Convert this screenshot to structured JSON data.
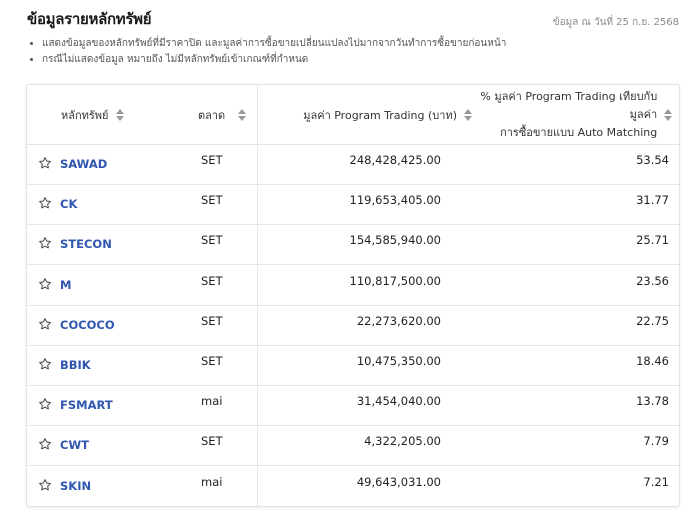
{
  "header": {
    "title": "ข้อมูลรายหลักทรัพย์",
    "as_of": "ข้อมูล ณ วันที่ 25 ก.ย. 2568"
  },
  "notes": [
    "แสดงข้อมูลของหลักทรัพย์ที่มีราคาปิด และมูลค่าการซื้อขายเปลี่ยนแปลงไปมากจากวันทำการซื้อขายก่อนหน้า",
    "กรณีไม่แสดงข้อมูล หมายถึง ไม่มีหลักทรัพย์เข้าเกณฑ์ที่กำหนด"
  ],
  "table": {
    "columns": {
      "symbol": "หลักทรัพย์",
      "market": "ตลาด",
      "value": "มูลค่า Program Trading (บาท)",
      "pct_line1": "% มูลค่า Program Trading เทียบกับมูลค่า",
      "pct_line2": "การซื้อขายแบบ Auto Matching"
    },
    "rows": [
      {
        "symbol": "SAWAD",
        "market": "SET",
        "value": "248,428,425.00",
        "pct": "53.54"
      },
      {
        "symbol": "CK",
        "market": "SET",
        "value": "119,653,405.00",
        "pct": "31.77"
      },
      {
        "symbol": "STECON",
        "market": "SET",
        "value": "154,585,940.00",
        "pct": "25.71"
      },
      {
        "symbol": "M",
        "market": "SET",
        "value": "110,817,500.00",
        "pct": "23.56"
      },
      {
        "symbol": "COCOCO",
        "market": "SET",
        "value": "22,273,620.00",
        "pct": "22.75"
      },
      {
        "symbol": "BBIK",
        "market": "SET",
        "value": "10,475,350.00",
        "pct": "18.46"
      },
      {
        "symbol": "FSMART",
        "market": "mai",
        "value": "31,454,040.00",
        "pct": "13.78"
      },
      {
        "symbol": "CWT",
        "market": "SET",
        "value": "4,322,205.00",
        "pct": "7.79"
      },
      {
        "symbol": "SKIN",
        "market": "mai",
        "value": "49,643,031.00",
        "pct": "7.21"
      }
    ]
  },
  "icons": {
    "favorite": "star-outline-icon",
    "sort": "sort-icon"
  },
  "colors": {
    "symbol_link": "#2f56b0",
    "border": "#e3e3e3",
    "muted_text": "#8a8a8a"
  }
}
